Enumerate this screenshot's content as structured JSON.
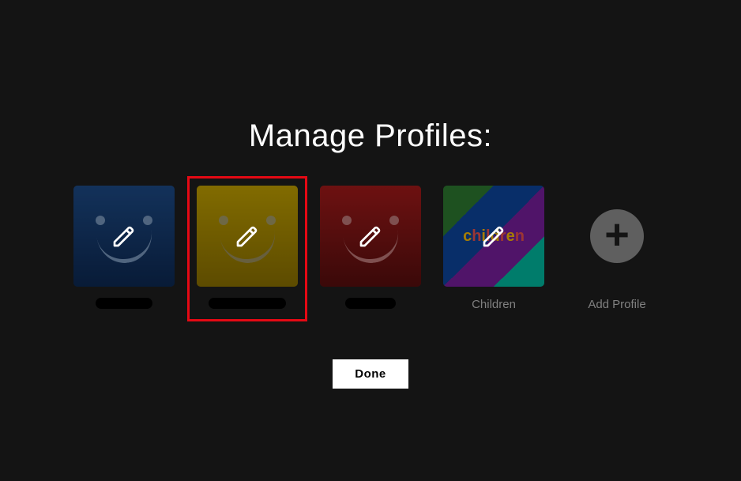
{
  "title": "Manage Profiles:",
  "profiles": [
    {
      "name": "",
      "redacted": true,
      "redactWidth": 72,
      "type": "face",
      "bg": "linear-gradient(#1e4d8b,#0d2a55)",
      "eye": "#7b9cc4",
      "smile": "#7b9cc4"
    },
    {
      "name": "",
      "redacted": true,
      "redactWidth": 98,
      "type": "face",
      "bg": "linear-gradient(#c7a500,#8f7400)",
      "eye": "#aaa06a",
      "smile": "#9e9360",
      "highlighted": true
    },
    {
      "name": "",
      "redacted": true,
      "redactWidth": 64,
      "type": "face",
      "bg": "linear-gradient(#a81b1b,#5a0e0e)",
      "eye": "#c47b7b",
      "smile": "#c47b7b"
    },
    {
      "name": "Children",
      "redacted": false,
      "type": "children"
    },
    {
      "name": "Add Profile",
      "redacted": false,
      "type": "add"
    }
  ],
  "doneLabel": "Done",
  "childrenWord": "children"
}
